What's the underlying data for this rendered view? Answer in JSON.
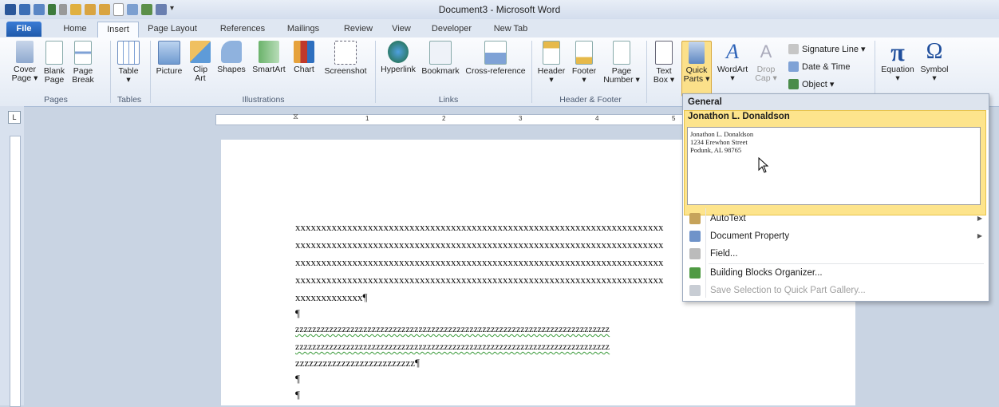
{
  "window": {
    "title": "Document3 - Microsoft Word"
  },
  "tabs": [
    "File",
    "Home",
    "Insert",
    "Page Layout",
    "References",
    "Mailings",
    "Review",
    "View",
    "Developer",
    "New Tab"
  ],
  "ribbon": {
    "pages": {
      "cover": "Cover\nPage ▾",
      "blank": "Blank\nPage",
      "break": "Page\nBreak",
      "label": "Pages"
    },
    "tables": {
      "table": "Table\n▾",
      "label": "Tables"
    },
    "illustrations": {
      "picture": "Picture",
      "clipart": "Clip\nArt",
      "shapes": "Shapes",
      "smartart": "SmartArt",
      "chart": "Chart",
      "screenshot": "Screenshot",
      "label": "Illustrations"
    },
    "links": {
      "hyperlink": "Hyperlink",
      "bookmark": "Bookmark",
      "crossref": "Cross-reference",
      "label": "Links"
    },
    "headerfooter": {
      "header": "Header\n▾",
      "footer": "Footer\n▾",
      "pagenumber": "Page\nNumber ▾",
      "label": "Header & Footer"
    },
    "text": {
      "textbox": "Text\nBox ▾",
      "quickparts": "Quick\nParts ▾",
      "wordart": "WordArt\n▾",
      "dropcap": "Drop\nCap ▾",
      "signature": "Signature Line ▾",
      "datetime": "Date & Time",
      "object": "Object ▾"
    },
    "symbols": {
      "equation": "Equation\n▾",
      "symbol": "Symbol\n▾",
      "pi": "π",
      "omega": "Ω"
    }
  },
  "ruler": {
    "ticks": [
      "1",
      "2",
      "3",
      "4",
      "5"
    ]
  },
  "document": {
    "lines": [
      "xxxxxxxxxxxxxxxxxxxxxxxxxxxxxxxxxxxxxxxxxxxxxxxxxxxxxxxxxxxxxxxxxxxxxxx",
      "xxxxxxxxxxxxxxxxxxxxxxxxxxxxxxxxxxxxxxxxxxxxxxxxxxxxxxxxxxxxxxxxxxxxxxx",
      "xxxxxxxxxxxxxxxxxxxxxxxxxxxxxxxxxxxxxxxxxxxxxxxxxxxxxxxxxxxxxxxxxxxxxxx",
      "xxxxxxxxxxxxxxxxxxxxxxxxxxxxxxxxxxxxxxxxxxxxxxxxxxxxxxxxxxxxxxxxxxxxxxx",
      "xxxxxxxxxxxxx¶",
      "¶",
      "zzzzzzzzzzzzzzzzzzzzzzzzzzzzzzzzzzzzzzzzzzzzzzzzzzzzzzzzzzzzzzzzzzzzzzzzzz",
      "zzzzzzzzzzzzzzzzzzzzzzzzzzzzzzzzzzzzzzzzzzzzzzzzzzzzzzzzzzzzzzzzzzzzzzzzzz",
      "zzzzzzzzzzzzzzzzzzzzzzzzzz¶",
      "¶",
      "¶"
    ]
  },
  "quickparts_menu": {
    "section": "General",
    "entry_title": "Jonathon L. Donaldson",
    "preview": [
      "Jonathon L. Donaldson",
      "1234 Erewhon Street",
      "Podunk, AL 98765"
    ],
    "items": [
      {
        "label": "AutoText",
        "submenu": true,
        "enabled": true
      },
      {
        "label": "Document Property",
        "submenu": true,
        "enabled": true
      },
      {
        "label": "Field...",
        "submenu": false,
        "enabled": true
      },
      {
        "label": "Building Blocks Organizer...",
        "submenu": false,
        "enabled": true
      },
      {
        "label": "Save Selection to Quick Part Gallery...",
        "submenu": false,
        "enabled": false
      }
    ]
  }
}
